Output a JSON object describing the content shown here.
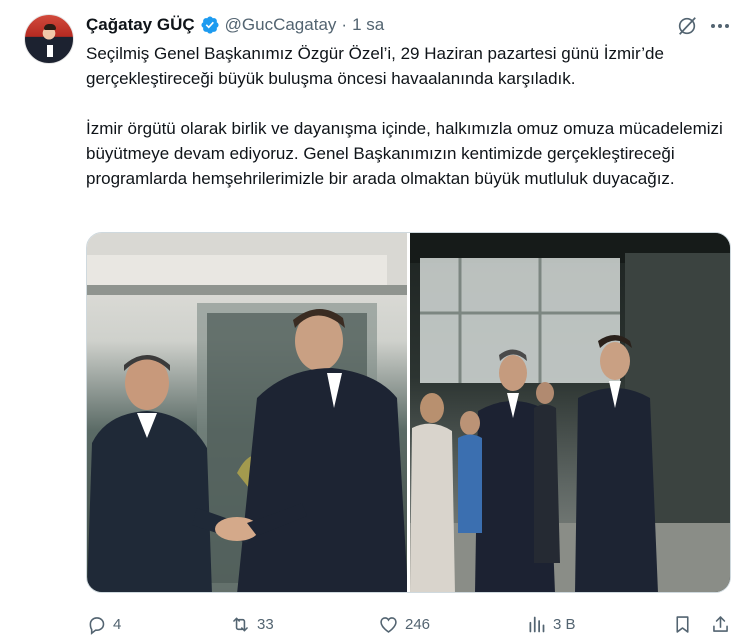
{
  "author": {
    "name": "Çağatay GÜÇ",
    "handle": "@GucCagatay",
    "separator": "·",
    "time": "1 sa"
  },
  "tweet": {
    "paragraph_1": "Seçilmiş Genel Başkanımız Özgür Özel’i, 29 Haziran pazartesi günü İzmir’de gerçekleştireceği büyük buluşma öncesi havaalanında karşıladık.",
    "paragraph_2": "İzmir örgütü olarak birlik ve dayanışma içinde, halkımızla omuz omuza mücadelemizi büyütmeye devam ediyoruz. Genel Başkanımızın kentimizde gerçekleştireceği programlarda hemşehrilerimizle bir arada olmaktan büyük mutluluk duyacağız."
  },
  "metrics": {
    "replies": "4",
    "retweets": "33",
    "likes": "246",
    "views": "3 B"
  },
  "colors": {
    "verified": "#1d9bf0",
    "secondary_text": "#536471",
    "primary_text": "#0f1419"
  },
  "icons": {
    "verified": "verified-badge-icon",
    "grok": "grok-icon",
    "more": "more-icon",
    "reply": "reply-icon",
    "retweet": "retweet-icon",
    "like": "like-icon",
    "views": "views-icon",
    "bookmark": "bookmark-icon",
    "share": "share-icon"
  }
}
